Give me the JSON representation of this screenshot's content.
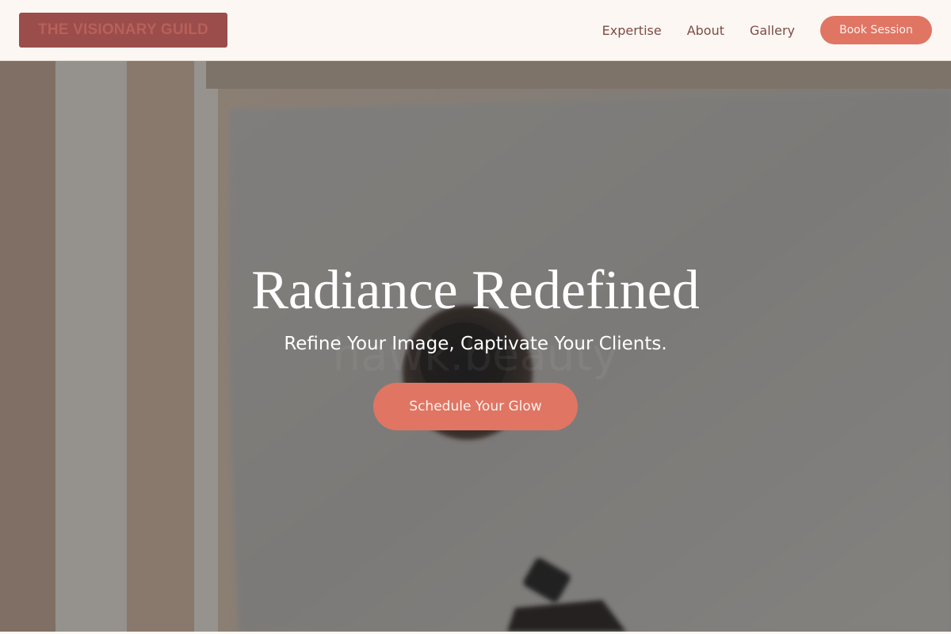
{
  "header": {
    "brand": "THE VISIONARY GUILD",
    "nav": [
      {
        "label": "Expertise"
      },
      {
        "label": "About"
      },
      {
        "label": "Gallery"
      }
    ],
    "book_button": "Book Session"
  },
  "hero": {
    "title": "Radiance Redefined",
    "subtitle": "Refine Your Image, Captivate Your Clients.",
    "cta": "Schedule Your Glow",
    "watermark": "hawk.beauty"
  },
  "colors": {
    "accent": "#e07563",
    "brand_bg": "#9b4d4b",
    "nav_text": "#7d4b45",
    "header_bg": "#fdf7f4"
  },
  "icons": [
    "cosmetic-jar-image",
    "dropper-bottle-image"
  ]
}
